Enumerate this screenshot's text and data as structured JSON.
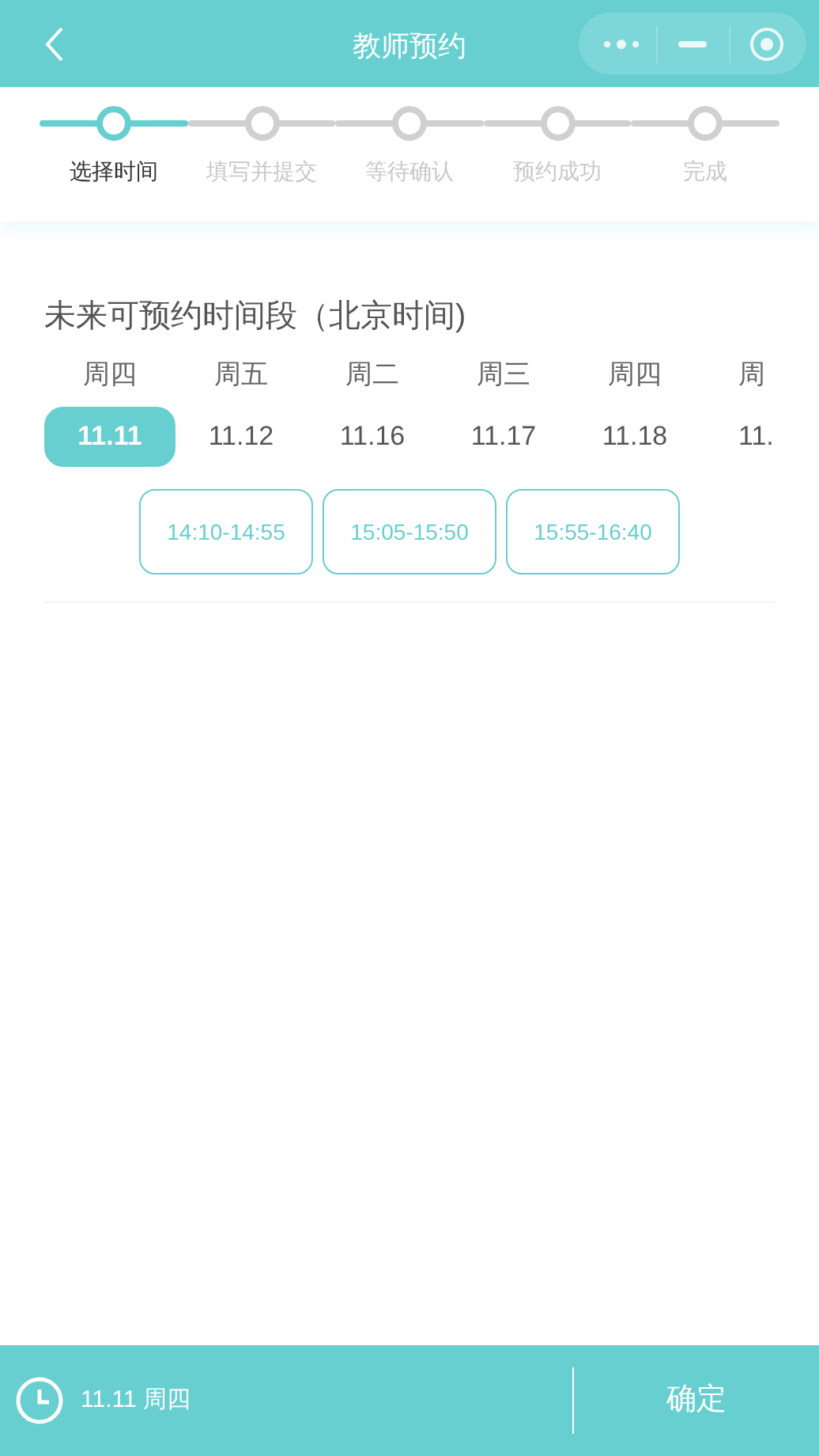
{
  "header": {
    "title": "教师预约"
  },
  "steps": [
    {
      "label": "选择时间",
      "active": true
    },
    {
      "label": "填写并提交",
      "active": false
    },
    {
      "label": "等待确认",
      "active": false
    },
    {
      "label": "预约成功",
      "active": false
    },
    {
      "label": "完成",
      "active": false
    }
  ],
  "section_title": "未来可预约时间段（北京时间)",
  "days": [
    {
      "weekday": "周四",
      "date": "11.11",
      "selected": true
    },
    {
      "weekday": "周五",
      "date": "11.12",
      "selected": false
    },
    {
      "weekday": "周二",
      "date": "11.16",
      "selected": false
    },
    {
      "weekday": "周三",
      "date": "11.17",
      "selected": false
    },
    {
      "weekday": "周四",
      "date": "11.18",
      "selected": false
    },
    {
      "weekday": "周",
      "date": "11.",
      "selected": false
    }
  ],
  "time_slots": [
    "14:10-14:55",
    "15:05-15:50",
    "15:55-16:40"
  ],
  "footer": {
    "summary": "11.11 周四",
    "confirm": "确定"
  }
}
